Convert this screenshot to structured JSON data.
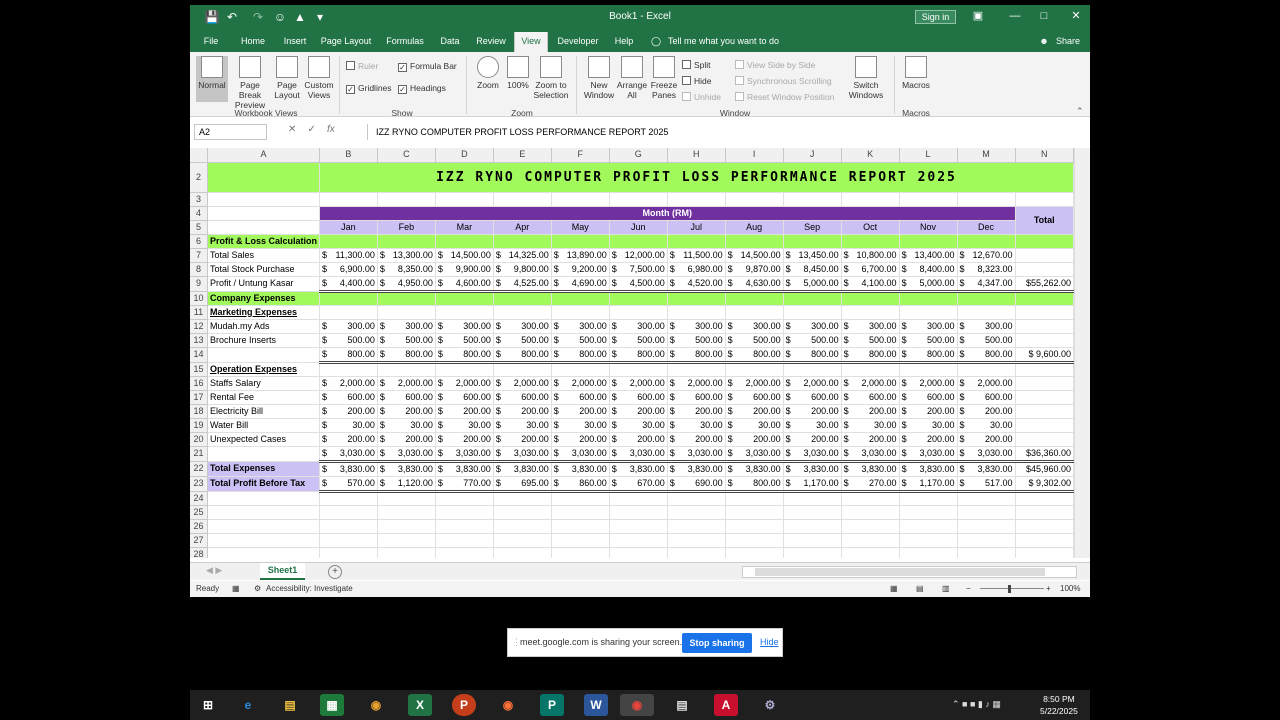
{
  "window": {
    "title": "Book1  -  Excel",
    "sign_in": "Sign in",
    "share": "Share"
  },
  "tabs": [
    "File",
    "Home",
    "Insert",
    "Page Layout",
    "Formulas",
    "Data",
    "Review",
    "View",
    "Developer",
    "Help"
  ],
  "tell_me": "Tell me what you want to do",
  "ribbon": {
    "workbook_views": {
      "normal": "Normal",
      "page_break": "Page Break Preview",
      "page_layout": "Page Layout",
      "custom": "Custom Views",
      "label": "Workbook Views"
    },
    "show": {
      "ruler": "Ruler",
      "formula_bar": "Formula Bar",
      "gridlines": "Gridlines",
      "headings": "Headings",
      "label": "Show"
    },
    "zoom": {
      "zoom": "Zoom",
      "pct": "100%",
      "zoom_sel": "Zoom to Selection",
      "label": "Zoom"
    },
    "window": {
      "new": "New Window",
      "arrange": "Arrange All",
      "freeze": "Freeze Panes",
      "split": "Split",
      "hide": "Hide",
      "unhide": "Unhide",
      "side": "View Side by Side",
      "sync": "Synchronous Scrolling",
      "reset": "Reset Window Position",
      "switch": "Switch Windows",
      "label": "Window"
    },
    "macros": {
      "macros": "Macros",
      "label": "Macros"
    }
  },
  "namebox": "A2",
  "formula": "IZZ RYNO COMPUTER PROFIT LOSS PERFORMANCE REPORT 2025",
  "columns": [
    "A",
    "B",
    "C",
    "D",
    "E",
    "F",
    "G",
    "H",
    "I",
    "J",
    "K",
    "L",
    "M",
    "N"
  ],
  "sheet": {
    "title": "IZZ RYNO COMPUTER PROFIT LOSS PERFORMANCE REPORT 2025",
    "month_header": "Month (RM)",
    "total_header": "Total",
    "months": [
      "Jan",
      "Feb",
      "Mar",
      "Apr",
      "May",
      "Jun",
      "Jul",
      "Aug",
      "Sep",
      "Oct",
      "Nov",
      "Dec"
    ],
    "pl_calc": "Profit & Loss Calculation",
    "total_sales": {
      "label": "Total Sales",
      "vals": [
        "11,300.00",
        "13,300.00",
        "14,500.00",
        "14,325.00",
        "13,890.00",
        "12,000.00",
        "11,500.00",
        "14,500.00",
        "13,450.00",
        "10,800.00",
        "13,400.00",
        "12,670.00"
      ]
    },
    "stock": {
      "label": "Total Stock Purchase",
      "vals": [
        "6,900.00",
        "8,350.00",
        "9,900.00",
        "9,800.00",
        "9,200.00",
        "7,500.00",
        "6,980.00",
        "9,870.00",
        "8,450.00",
        "6,700.00",
        "8,400.00",
        "8,323.00"
      ]
    },
    "gross": {
      "label": "Profit / Untung Kasar",
      "vals": [
        "4,400.00",
        "4,950.00",
        "4,600.00",
        "4,525.00",
        "4,690.00",
        "4,500.00",
        "4,520.00",
        "4,630.00",
        "5,000.00",
        "4,100.00",
        "5,000.00",
        "4,347.00"
      ],
      "total": "$55,262.00"
    },
    "company_exp": "Company Expenses",
    "marketing": "Marketing Expenses",
    "mudah": {
      "label": "Mudah.my Ads",
      "val": "300.00"
    },
    "brochure": {
      "label": "Brochure Inserts",
      "val": "500.00"
    },
    "mkt_sub": {
      "val": "800.00",
      "total": "$  9,600.00"
    },
    "operation": "Operation Expenses",
    "staff": {
      "label": "Staffs Salary",
      "val": "2,000.00"
    },
    "rental": {
      "label": "Rental Fee",
      "val": "600.00"
    },
    "electric": {
      "label": "Electricity Bill",
      "val": "200.00"
    },
    "water": {
      "label": "Water Bill",
      "val": "30.00"
    },
    "unexpected": {
      "label": "Unexpected Cases",
      "val": "200.00"
    },
    "op_sub": {
      "val": "3,030.00",
      "total": "$36,360.00"
    },
    "total_exp": {
      "label": "Total Expenses",
      "val": "3,830.00",
      "total": "$45,960.00"
    },
    "net": {
      "label": "Total Profit Before Tax",
      "vals": [
        "570.00",
        "1,120.00",
        "770.00",
        "695.00",
        "860.00",
        "670.00",
        "690.00",
        "800.00",
        "1,170.00",
        "270.00",
        "1,170.00",
        "517.00"
      ],
      "total": "$  9,302.00"
    },
    "currency": "$"
  },
  "sheet_tab": "Sheet1",
  "status": {
    "ready": "Ready",
    "accessibility": "Accessibility: Investigate",
    "zoom": "100%"
  },
  "share_banner": {
    "text": "meet.google.com is sharing your screen.",
    "stop": "Stop sharing",
    "hide": "Hide"
  },
  "clock": {
    "time": "8:50 PM",
    "date": "5/22/2025"
  }
}
